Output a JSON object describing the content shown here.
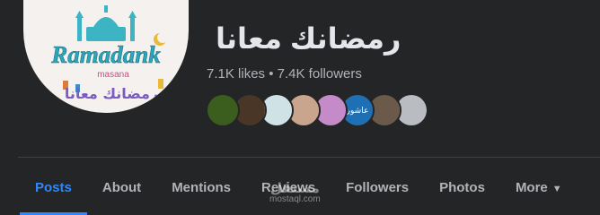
{
  "page": {
    "name": "رمضانك معانا",
    "likes": "7.1K likes",
    "separator": "•",
    "followers": "7.4K followers"
  },
  "profile_photo": {
    "logo_text_latin": "Ramadank",
    "logo_text_sub": "masana",
    "logo_text_arabic": "رمضانك معانا"
  },
  "friends": [
    {
      "icon": "friend-avatar",
      "color": "#3b5d1e",
      "label": ""
    },
    {
      "icon": "friend-avatar",
      "color": "#4a3626",
      "label": ""
    },
    {
      "icon": "friend-avatar",
      "color": "#cfe3e6",
      "label": ""
    },
    {
      "icon": "friend-avatar",
      "color": "#c9a58d",
      "label": ""
    },
    {
      "icon": "friend-avatar",
      "color": "#c48bc8",
      "label": ""
    },
    {
      "icon": "friend-avatar",
      "color": "#1f6fb5",
      "label": "عاشور"
    },
    {
      "icon": "friend-avatar",
      "color": "#6b5a4a",
      "label": ""
    },
    {
      "icon": "friend-avatar",
      "color": "#b9bcc0",
      "label": ""
    }
  ],
  "tabs": [
    {
      "label": "Posts",
      "active": true
    },
    {
      "label": "About",
      "active": false
    },
    {
      "label": "Mentions",
      "active": false
    },
    {
      "label": "Reviews",
      "active": false
    },
    {
      "label": "Followers",
      "active": false
    },
    {
      "label": "Photos",
      "active": false
    },
    {
      "label": "More",
      "active": false
    }
  ],
  "more_caret_icon": "caret-down-icon",
  "watermark": {
    "arabic": "مستقل",
    "latin": "mostaql.com"
  },
  "colors": {
    "background": "#242526",
    "accent": "#2d88ff",
    "text_primary": "#e4e6eb",
    "text_secondary": "#b0b3b8"
  }
}
